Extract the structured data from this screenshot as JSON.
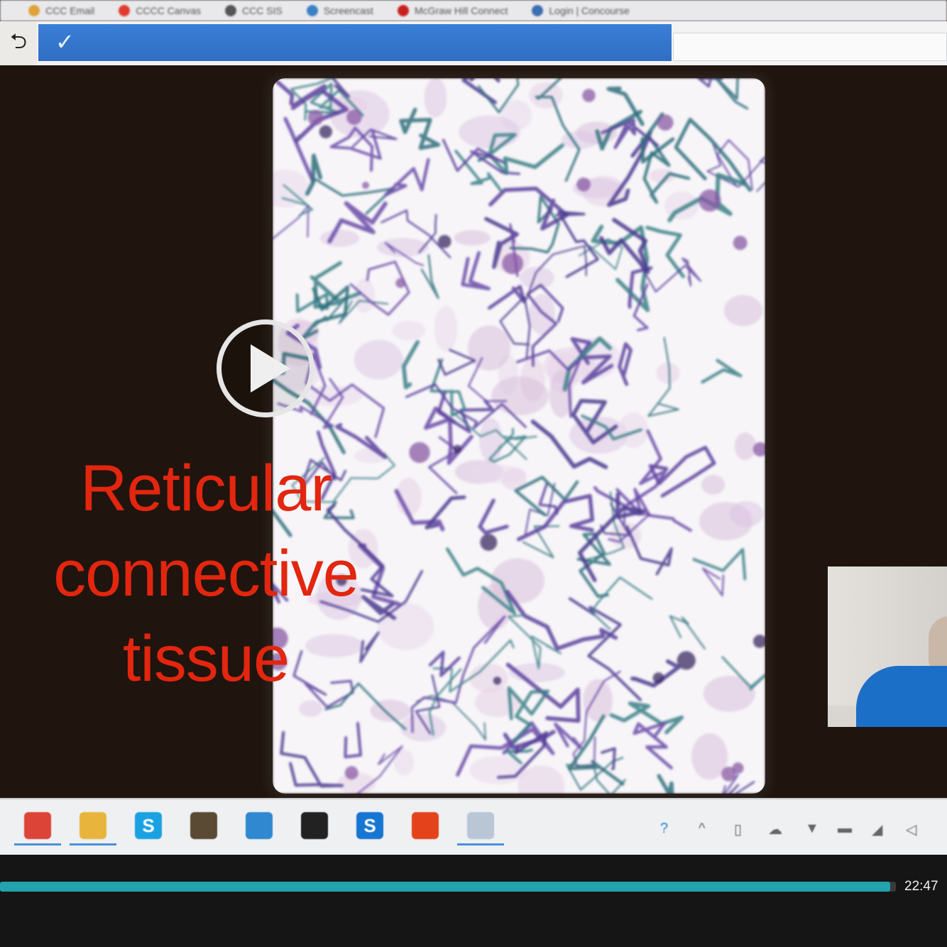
{
  "browser": {
    "bookmarks": [
      {
        "label": "CCC Email",
        "color": "#e0a13a"
      },
      {
        "label": "CCCC Canvas",
        "color": "#e03b2e"
      },
      {
        "label": "CCC SIS",
        "color": "#555555"
      },
      {
        "label": "Screencast",
        "color": "#3b82c4"
      },
      {
        "label": "McGraw Hill Connect",
        "color": "#c8201d"
      },
      {
        "label": "Login | Concourse",
        "color": "#3d6fb0"
      }
    ]
  },
  "header": {
    "back_icon": "back-arrow-icon",
    "check_symbol": "✓"
  },
  "video": {
    "caption_lines": [
      "Reticular",
      "connective",
      "tissue"
    ],
    "progress": 0.994,
    "time": "22:47",
    "colors": {
      "caption": "#e2260f",
      "progress": "#23a3ad"
    }
  },
  "taskbar": {
    "apps": [
      {
        "name": "chrome-icon",
        "glyph": "",
        "color": "#db4437"
      },
      {
        "name": "file-explorer-icon",
        "glyph": "",
        "color": "#e8b43c"
      },
      {
        "name": "skype-icon",
        "glyph": "S",
        "color": "#1aa1e1"
      },
      {
        "name": "lock-store-icon",
        "glyph": "",
        "color": "#5a4a34"
      },
      {
        "name": "mail-icon",
        "glyph": "",
        "color": "#2f88d0"
      },
      {
        "name": "dropbox-icon",
        "glyph": "",
        "color": "#222222"
      },
      {
        "name": "screencast-icon",
        "glyph": "S",
        "color": "#1676d2"
      },
      {
        "name": "office-icon",
        "glyph": "",
        "color": "#e3421a"
      },
      {
        "name": "recorder-icon",
        "glyph": "",
        "color": "#b9c6d6"
      }
    ]
  }
}
